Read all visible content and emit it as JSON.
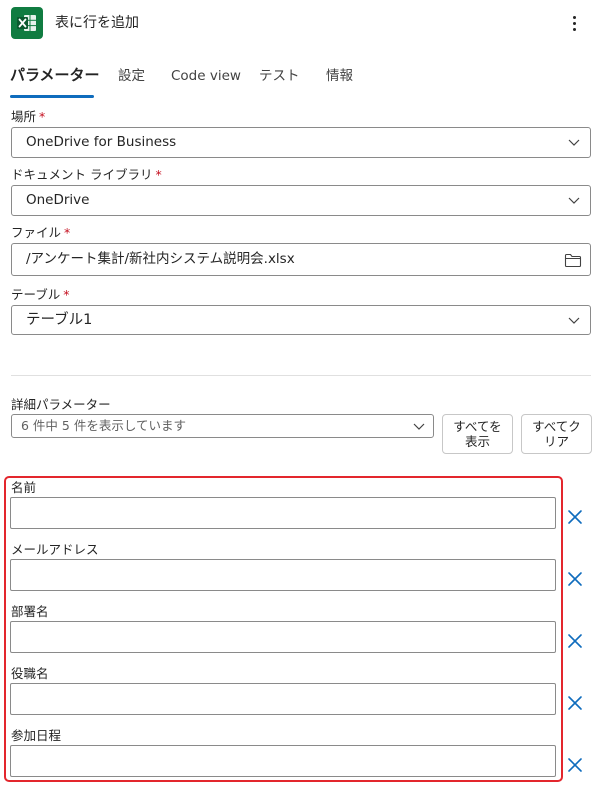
{
  "header": {
    "title": "表に行を追加",
    "app_icon": "excel-icon",
    "more_icon": "more-vertical-icon"
  },
  "tabs": [
    {
      "label": "パラメーター",
      "active": true
    },
    {
      "label": "設定",
      "active": false
    },
    {
      "label": "Code view",
      "active": false
    },
    {
      "label": "テスト",
      "active": false
    },
    {
      "label": "情報",
      "active": false
    }
  ],
  "required_mark": "*",
  "fields": {
    "location": {
      "label": "場所",
      "value": "OneDrive for Business"
    },
    "document_library": {
      "label": "ドキュメント ライブラリ",
      "value": "OneDrive"
    },
    "file": {
      "label": "ファイル",
      "value": "/アンケート集計/新社内システム説明会.xlsx",
      "icon": "folder-icon"
    },
    "table": {
      "label": "テーブル",
      "value": "テーブル1"
    }
  },
  "advanced": {
    "label": "詳細パラメーター",
    "summary": "6 件中 5 件を表示しています",
    "show_all_label_line1": "すべてを",
    "show_all_label_line2": "表示",
    "clear_all_label_line1": "すべてク",
    "clear_all_label_line2": "リア"
  },
  "parameters": [
    {
      "label": "名前",
      "value": ""
    },
    {
      "label": "メールアドレス",
      "value": ""
    },
    {
      "label": "部署名",
      "value": ""
    },
    {
      "label": "役職名",
      "value": ""
    },
    {
      "label": "参加日程",
      "value": ""
    }
  ],
  "colors": {
    "accent": "#0f6cbd",
    "excel_green": "#107c41",
    "required": "#c50f1f",
    "highlight": "#e3262d"
  }
}
